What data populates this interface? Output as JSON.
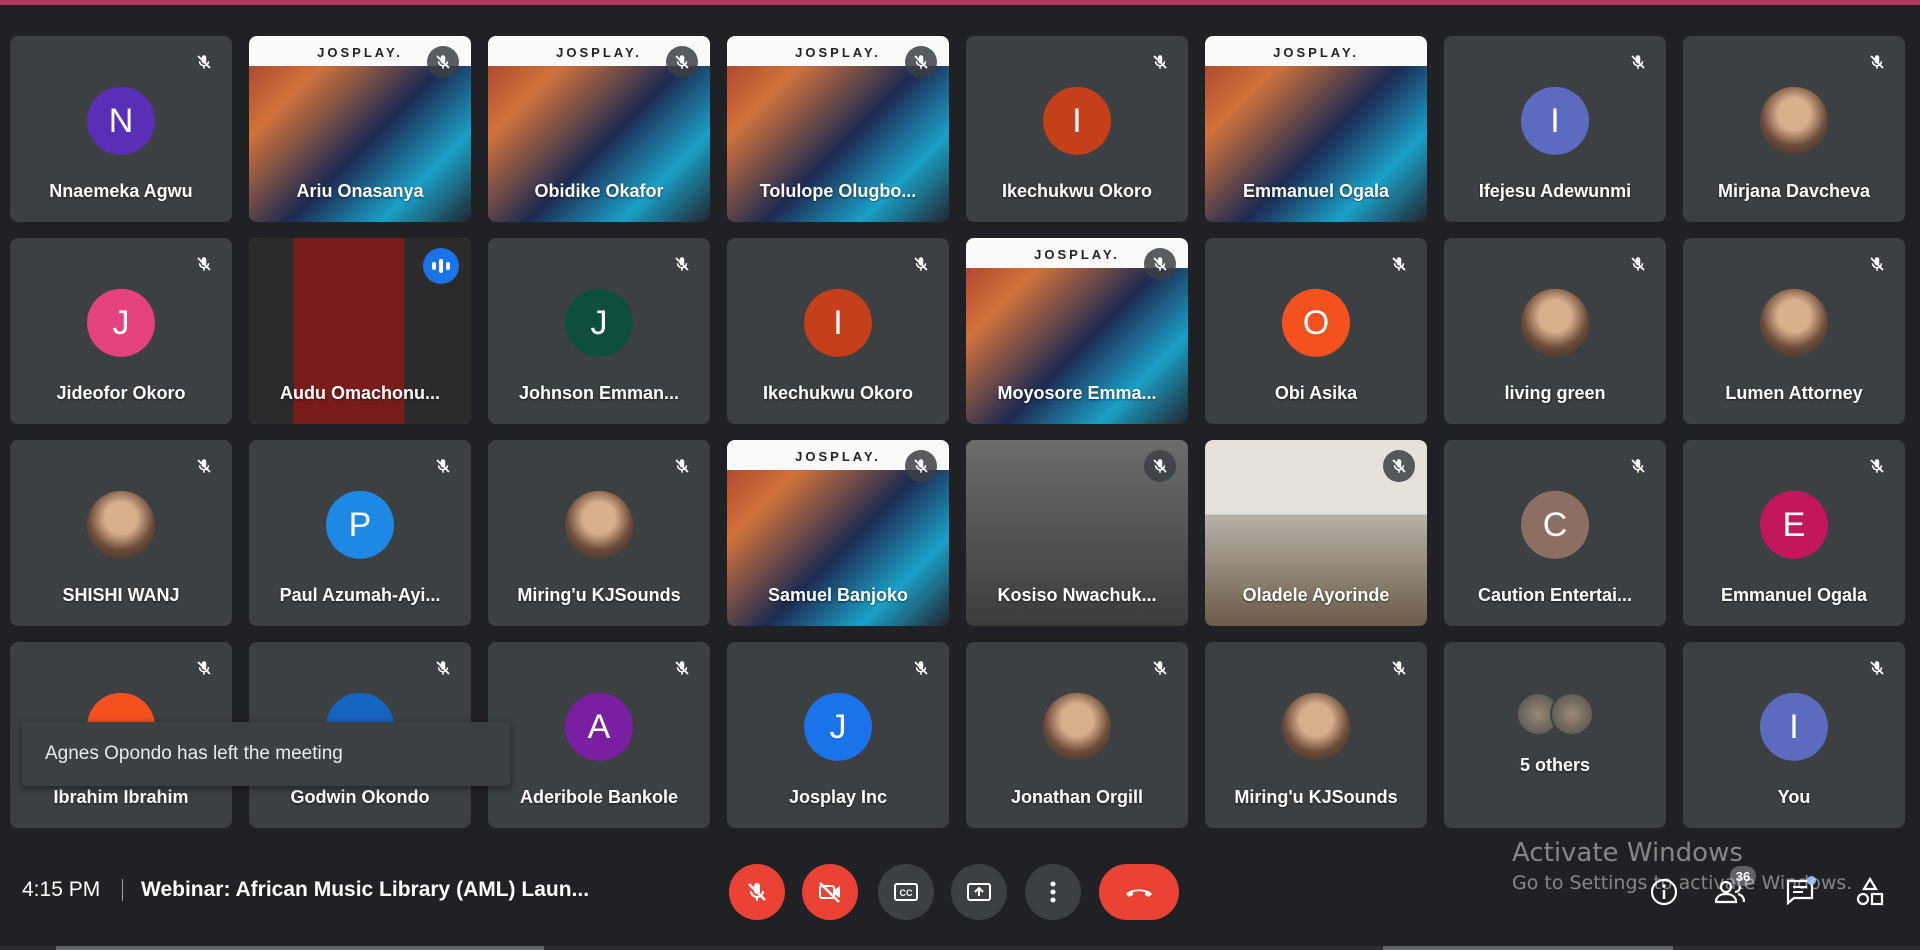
{
  "colors": {
    "accent_blue": "#8ab4f8",
    "danger_red": "#ea4335",
    "tile_bg": "#3c4043",
    "page_bg": "#202124",
    "topbar": "#b03a5f"
  },
  "participants": [
    {
      "name": "Nnaemeka Agwu",
      "initial": "N",
      "avatar_color": "#5b2eb8",
      "video": "none",
      "muted": true
    },
    {
      "name": "Ariu Onasanya",
      "video": "josplay",
      "muted": true
    },
    {
      "name": "Obidike Okafor",
      "video": "josplay",
      "muted": true
    },
    {
      "name": "Tolulope Olugbo...",
      "video": "josplay",
      "muted": true
    },
    {
      "name": "Ikechukwu Okoro",
      "initial": "I",
      "avatar_color": "#c5401a",
      "video": "none",
      "muted": true
    },
    {
      "name": "Emmanuel Ogala",
      "video": "josplay",
      "muted": false
    },
    {
      "name": "Ifejesu Adewunmi",
      "initial": "I",
      "avatar_color": "#5c6bc0",
      "video": "none",
      "muted": true
    },
    {
      "name": "Mirjana Davcheva",
      "initial": "",
      "avatar_color": "photo",
      "video": "none",
      "muted": true
    },
    {
      "name": "Jideofor Okoro",
      "initial": "J",
      "avatar_color": "#e5437f",
      "video": "none",
      "muted": true
    },
    {
      "name": "Audu Omachonu...",
      "video": "red",
      "muted": false,
      "speaking": true
    },
    {
      "name": "Johnson Emman...",
      "initial": "J",
      "avatar_color": "#0d4f3c",
      "video": "none",
      "muted": true
    },
    {
      "name": "Ikechukwu Okoro",
      "initial": "I",
      "avatar_color": "#c5401a",
      "video": "none",
      "muted": true
    },
    {
      "name": "Moyosore Emma...",
      "video": "josplay",
      "muted": true
    },
    {
      "name": "Obi Asika",
      "initial": "O",
      "avatar_color": "#f4511e",
      "video": "none",
      "muted": true
    },
    {
      "name": "living green",
      "initial": "",
      "avatar_color": "photo",
      "video": "none",
      "muted": true
    },
    {
      "name": "Lumen Attorney",
      "initial": "",
      "avatar_color": "photo",
      "video": "none",
      "muted": true
    },
    {
      "name": "SHISHI WANJ",
      "initial": "",
      "avatar_color": "photo",
      "video": "none",
      "muted": true
    },
    {
      "name": "Paul Azumah-Ayi...",
      "initial": "P",
      "avatar_color": "#1e88e5",
      "video": "none",
      "muted": true
    },
    {
      "name": "Miring'u KJSounds",
      "initial": "",
      "avatar_color": "photo",
      "video": "none",
      "muted": true
    },
    {
      "name": "Samuel Banjoko",
      "video": "josplay",
      "muted": true
    },
    {
      "name": "Kosiso Nwachuk...",
      "video": "person",
      "muted": true
    },
    {
      "name": "Oladele Ayorinde",
      "video": "office",
      "muted": true
    },
    {
      "name": "Caution Entertai...",
      "initial": "C",
      "avatar_color": "#8d6e63",
      "video": "none",
      "muted": true
    },
    {
      "name": "Emmanuel Ogala",
      "initial": "E",
      "avatar_color": "#c2185b",
      "video": "none",
      "muted": true
    },
    {
      "name": "Ibrahim Ibrahim",
      "initial": "",
      "avatar_color": "#f4511e",
      "video": "none",
      "muted": true
    },
    {
      "name": "Godwin Okondo",
      "initial": "",
      "avatar_color": "#1565c0",
      "video": "none",
      "muted": true
    },
    {
      "name": "Aderibole Bankole",
      "initial": "A",
      "avatar_color": "#7b1fa2",
      "video": "none",
      "muted": true
    },
    {
      "name": "Josplay Inc",
      "initial": "J",
      "avatar_color": "#1a73e8",
      "video": "none",
      "muted": true
    },
    {
      "name": "Jonathan Orgill",
      "initial": "",
      "avatar_color": "photo",
      "video": "none",
      "muted": true
    },
    {
      "name": "Miring'u KJSounds",
      "initial": "",
      "avatar_color": "photo",
      "video": "none",
      "muted": true
    },
    {
      "name": "5 others",
      "video": "others",
      "muted": false
    },
    {
      "name": "You",
      "initial": "I",
      "avatar_color": "#5c6bc0",
      "video": "none",
      "muted": true
    }
  ],
  "josplay_brand": "JOSPLAY.",
  "toast": {
    "text": "Agnes Opondo has left the meeting"
  },
  "bottom": {
    "time": "4:15 PM",
    "separator": "|",
    "meeting_title": "Webinar: African Music Library (AML) Laun...",
    "participant_count": "36"
  },
  "controls": [
    {
      "name": "microphone-off-button",
      "icon": "mic-off-icon",
      "style": "red"
    },
    {
      "name": "camera-off-button",
      "icon": "camera-off-icon",
      "style": "red"
    },
    {
      "name": "captions-button",
      "icon": "captions-icon",
      "style": "gray"
    },
    {
      "name": "present-screen-button",
      "icon": "present-icon",
      "style": "gray"
    },
    {
      "name": "more-options-button",
      "icon": "more-vert-icon",
      "style": "gray"
    },
    {
      "name": "leave-call-button",
      "icon": "hangup-icon",
      "style": "hangup"
    }
  ],
  "watermark": {
    "line1": "Activate Windows",
    "line2": "Go to Settings to activate Windows."
  }
}
